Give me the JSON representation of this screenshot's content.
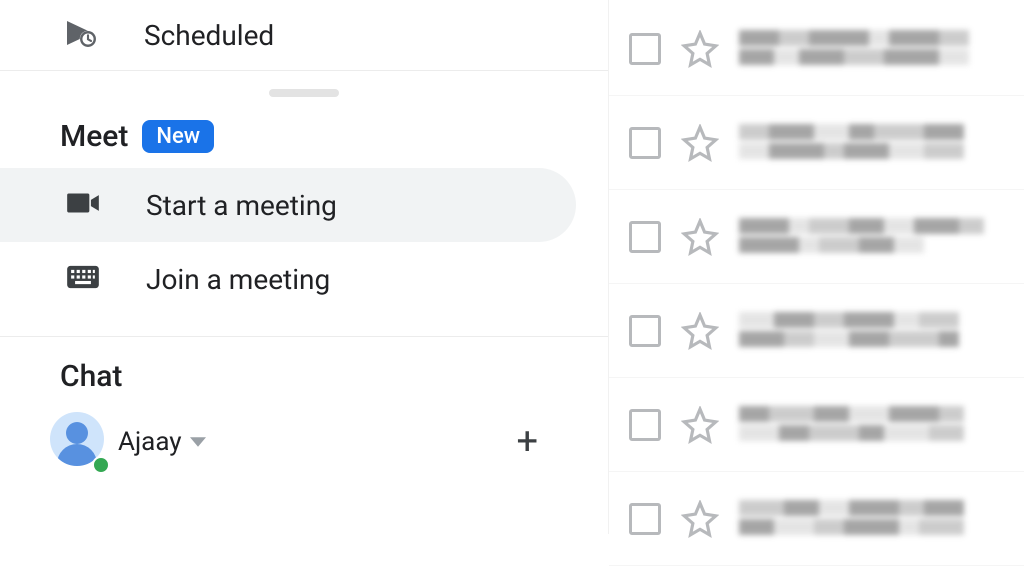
{
  "sidebar": {
    "scheduled_label": "Scheduled",
    "meet": {
      "title": "Meet",
      "badge": "New",
      "start_label": "Start a meeting",
      "join_label": "Join a meeting"
    },
    "chat": {
      "title": "Chat",
      "user_name": "Ajaay"
    }
  },
  "email_rows_count": 6
}
